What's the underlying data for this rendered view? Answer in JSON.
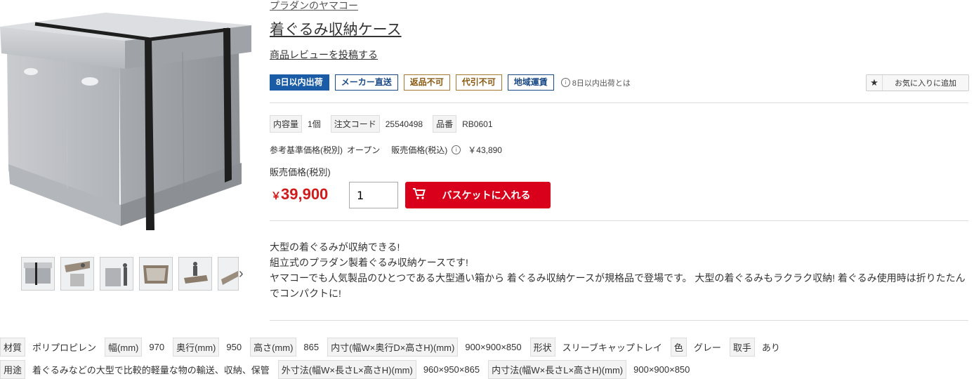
{
  "product": {
    "brand": "プラダンのヤマコー",
    "title": "着ぐるみ収納ケース",
    "review_link": "商品レビューを投稿する"
  },
  "badges": [
    {
      "label": "8日以内出荷",
      "style": "solid"
    },
    {
      "label": "メーカー直送",
      "style": "blue"
    },
    {
      "label": "返品不可",
      "style": "brown"
    },
    {
      "label": "代引不可",
      "style": "brown"
    },
    {
      "label": "地域運賃",
      "style": "blue"
    }
  ],
  "ship_info_link": "8日以内出荷とは",
  "favorite_button": "お気に入りに追加",
  "specs": [
    {
      "label": "内容量",
      "value": "1個"
    },
    {
      "label": "注文コード",
      "value": "25540498"
    },
    {
      "label": "品番",
      "value": "RB0601"
    }
  ],
  "reference_price": {
    "label": "参考基準価格(税別)",
    "value": "オープン",
    "sale_label": "販売価格(税込)",
    "sale_value": "￥43,890"
  },
  "price": {
    "label": "販売価格(税別)",
    "currency": "￥",
    "amount": "39,900"
  },
  "quantity": "1",
  "cart_button": "バスケットに入れる",
  "description": [
    "大型の着ぐるみが収納できる!",
    "組立式のプラダン製着ぐるみ収納ケースです!",
    "ヤマコーでも人気製品のひとつである大型通い箱から 着ぐるみ収納ケースが規格品で登場です。 大型の着ぐるみもラクラク収納! 着ぐるみ使用時は折りたたんでコンパクトに!"
  ],
  "spec_table_row1": [
    {
      "label": "材質",
      "value": "ポリプロピレン"
    },
    {
      "label": "幅(mm)",
      "value": "970"
    },
    {
      "label": "奥行(mm)",
      "value": "950"
    },
    {
      "label": "高さ(mm)",
      "value": "865"
    },
    {
      "label": "内寸(幅W×奥行D×高さH)(mm)",
      "value": "900×900×850"
    },
    {
      "label": "形状",
      "value": "スリーブキャップトレイ"
    },
    {
      "label": "色",
      "value": "グレー"
    },
    {
      "label": "取手",
      "value": "あり"
    }
  ],
  "spec_table_row2": [
    {
      "label": "用途",
      "value": "着ぐるみなどの大型で比較的軽量な物の輸送、収納、保管"
    },
    {
      "label": "外寸法(幅W×長さL×高さH)(mm)",
      "value": "960×950×865"
    },
    {
      "label": "内寸法(幅W×長さL×高さH)(mm)",
      "value": "900×900×850"
    }
  ],
  "colors": {
    "accent_red": "#d8001a",
    "price_red": "#d11a1a",
    "badge_blue": "#1a5da6",
    "badge_brown": "#a57a30"
  },
  "thumbnails": 6
}
